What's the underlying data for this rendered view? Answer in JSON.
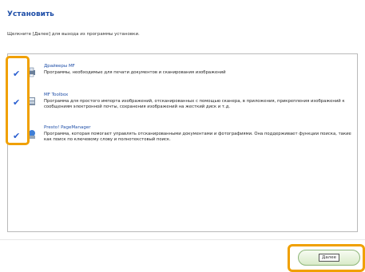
{
  "header": {
    "title": "Установить",
    "instruction": "Щелкните [Далее] для выхода из программы установки."
  },
  "components": [
    {
      "name": "Драйверы MF",
      "description": "Программы, необходимые для печати документов и сканирования изображений",
      "checked": true,
      "icon": "printer-icon"
    },
    {
      "name": "MF Toolbox",
      "description": "Программа для простого импорта изображений, отсканированных с помощью сканера, в приложения, прикрепления изображений к сообщениям электронной почты, сохранения изображений на жесткий диск и т.д.",
      "checked": true,
      "icon": "toolbox-icon"
    },
    {
      "name": "Presto! PageManager",
      "description": "Программа, которая помогает управлять отсканированными документами и фотографиями. Она поддерживает функции поиска, такие как поиск по ключевому слову и полнотекстовый поиск.",
      "checked": true,
      "icon": "pagemanager-icon"
    }
  ],
  "checkmark_glyph": "✔",
  "buttons": {
    "next_label": "Далее"
  },
  "colors": {
    "title": "#1f4fa8",
    "highlight": "#f0a000",
    "check": "#2a5fd0",
    "button_border": "#8fb77a"
  }
}
